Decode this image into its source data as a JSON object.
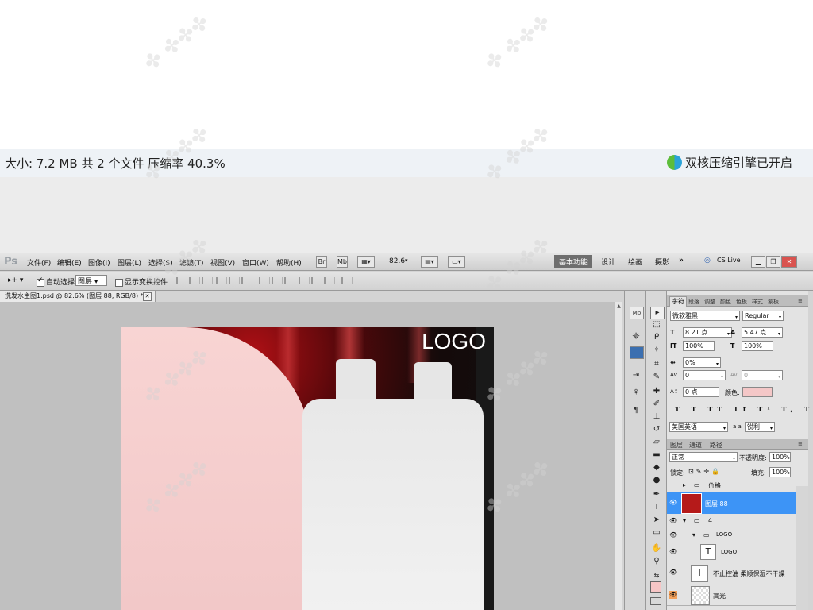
{
  "infobar": {
    "text": "大小: 7.2 MB 共 2 个文件 压缩率 40.3%",
    "brand": "双核压缩引擎已开启"
  },
  "menubar": {
    "app_logo": "Ps",
    "items": [
      "文件(F)",
      "编辑(E)",
      "图像(I)",
      "图层(L)",
      "选择(S)",
      "滤镜(T)",
      "视图(V)",
      "窗口(W)",
      "帮助(H)"
    ],
    "zoom": "82.6",
    "workspaces": [
      "基本功能",
      "设计",
      "绘画",
      "摄影"
    ],
    "more": "»",
    "cslive": "CS Live"
  },
  "options": {
    "auto_select_label": "自动选择:",
    "auto_select_value": "图层",
    "show_transform": "显示变换控件"
  },
  "document": {
    "tab_title": "洗发水主图1.psd @ 82.6% (图层 88, RGB/8) *",
    "logo_text": "LOGO"
  },
  "character_panel": {
    "tabs": [
      "字符",
      "段落",
      "调整",
      "颜色",
      "色板",
      "样式",
      "蒙板"
    ],
    "font_family": "微软雅黑",
    "font_style": "Regular",
    "font_size": "8.21 点",
    "leading": "5.47 点",
    "v_scale": "100%",
    "h_scale": "100%",
    "kerning": "0%",
    "tracking_left": "0",
    "tracking_right": "0",
    "baseline": "0 点",
    "color_label": "颜色:",
    "language": "美国英语",
    "aa_label": "a a",
    "antialias": "锐利",
    "color": "#f4c7c7"
  },
  "layers_panel": {
    "tabs": [
      "图层",
      "通道",
      "路径"
    ],
    "blend_mode": "正常",
    "opacity_label": "不透明度:",
    "opacity": "100%",
    "lock_label": "锁定:",
    "fill_label": "填充:",
    "fill": "100%",
    "rows": [
      {
        "name": "价格",
        "type": "group",
        "visible": false
      },
      {
        "name": "图层 88",
        "type": "pixel",
        "visible": true,
        "active": true
      },
      {
        "name": "4",
        "type": "group",
        "visible": true
      },
      {
        "name": "LOGO",
        "type": "group",
        "visible": true
      },
      {
        "name": "LOGO",
        "type": "text",
        "visible": true
      },
      {
        "name": "不止控油 柔顺保湿不干燥",
        "type": "text",
        "visible": true
      },
      {
        "name": "高光",
        "type": "pixel",
        "visible": true
      }
    ]
  }
}
